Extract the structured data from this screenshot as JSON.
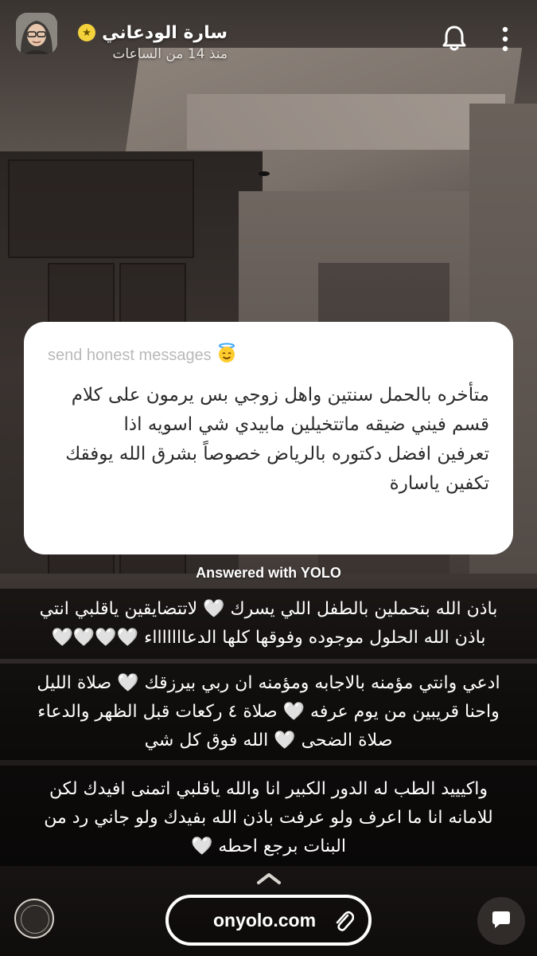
{
  "header": {
    "username": "سارة الودعاني",
    "timestamp": "منذ 14 من الساعات",
    "badge_icon": "star-icon"
  },
  "card": {
    "prompt": "send honest messages",
    "prompt_emoji": "halo-smiling-face-icon",
    "question_lines": [
      "متأخره بالحمل سنتين واهل زوجي بس يرمون على كلام",
      "قسم فيني ضيقه ماتتخيلين مابيدي شي اسويه اذا",
      "تعرفين افضل دكتوره بالرياض خصوصاً بشرق الله يوفقك",
      "تكفين ياسارة"
    ]
  },
  "answered_label": "Answered with YOLO",
  "captions": [
    {
      "lines": [
        "باذن الله بتحملين بالطفل اللي يسرك 🤍 لاتتضايقين ياقلبي انتي",
        "باذن الله الحلول موجوده وفوقها كلها الدعاااااااء 🤍🤍🤍🤍"
      ]
    },
    {
      "lines": [
        "ادعي وانتي مؤمنه بالاجابه ومؤمنه ان ربي بيرزقك 🤍 صلاة الليل",
        "واحنا قريبين من يوم عرفه 🤍 صلاة ٤ ركعات قبل الظهر والدعاء",
        "صلاة الضحى 🤍 الله فوق كل شي"
      ]
    },
    {
      "lines": [
        "واكيييد الطب له الدور الكبير انا والله ياقلبي اتمنى افيدك لكن",
        "للامانه انا ما اعرف ولو عرفت باذن الله بفيدك ولو جاني رد من",
        "البنات برجع احطه 🤍"
      ]
    }
  ],
  "bottom": {
    "link_text": "onyolo.com",
    "link_icon": "paperclip-icon",
    "reply_icon": "chat-bubble-icon",
    "swipe_icon": "chevron-up-icon"
  },
  "colors": {
    "card_bg": "#ffffff",
    "prompt_gray": "#b9b9b9",
    "caption_band": "#000000",
    "badge_yellow": "#f4d23c"
  }
}
